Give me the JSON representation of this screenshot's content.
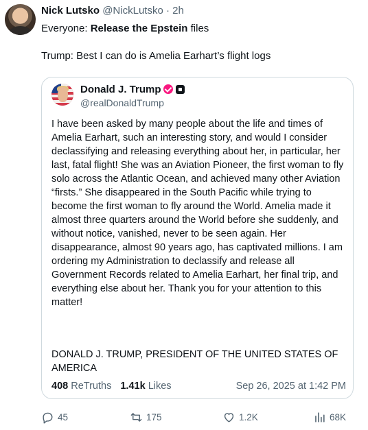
{
  "tweet": {
    "author": {
      "name": "Nick Lutsko",
      "handle": "@NickLutsko",
      "separator": "·",
      "time": "2h"
    },
    "text": {
      "line1_prefix": "Everyone: ",
      "line1_bold": "Release the Epstein",
      "line1_suffix": " files",
      "line2": "Trump: Best I can do is Amelia Earhart’s flight logs"
    },
    "quote": {
      "name": "Donald J. Trump",
      "handle": "@realDonaldTrump",
      "body": "I have been asked by many people about the life and times of Amelia Earhart, such an interesting story, and would I consider declassifying and releasing everything about her, in particular, her last, fatal flight! She was an Aviation Pioneer, the first woman to fly solo across the Atlantic Ocean, and achieved many other Aviation “firsts.” She disappeared in the South Pacific while trying to become the first woman to fly around the World. Amelia made it almost three quarters around the World before she suddenly, and without notice, vanished, never to be seen again. Her disappearance, almost 90 years ago, has captivated millions. I am ordering my Administration to declassify and release all Government Records related to Amelia Earhart, her final trip, and everything else about her. Thank you for your attention to this matter!",
      "signature": "DONALD J. TRUMP, PRESIDENT OF THE UNITED STATES OF AMERICA",
      "retruths_count": "408",
      "retruths_label": "ReTruths",
      "likes_count": "1.41k",
      "likes_label": "Likes",
      "date": "Sep 26, 2025 at 1:42 PM"
    },
    "actions": {
      "replies": "45",
      "reposts": "175",
      "likes": "1.2K",
      "views": "68K"
    }
  },
  "icons": {
    "reply": "reply-icon",
    "repost": "repost-icon",
    "like": "heart-icon",
    "views": "views-icon",
    "verified": "verified-badge-icon"
  },
  "colors": {
    "text": "#0f1419",
    "secondary": "#536471",
    "border": "#cfd9de",
    "badge": "#f91880"
  }
}
